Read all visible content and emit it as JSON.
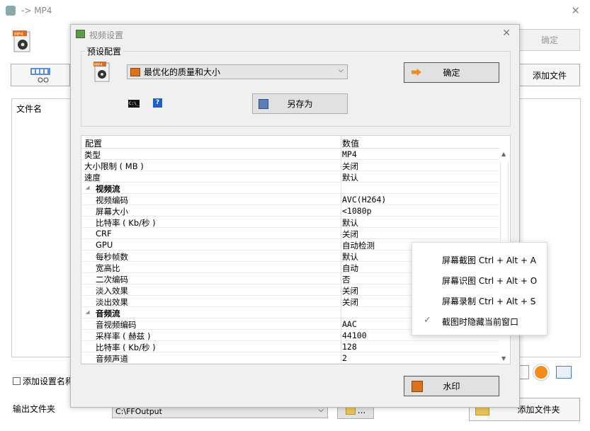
{
  "main_window": {
    "title": "-> MP4",
    "ok_button": "确定",
    "add_file_button": "添加文件",
    "file_name_header": "文件名",
    "add_settings_name_checkbox": "添加设置名称",
    "output_folder_label": "输出文件夹",
    "output_folder_value": "C:\\FFOutput",
    "browse_label": "...",
    "add_folder_button": "添加文件夹"
  },
  "dialog": {
    "title": "视频设置",
    "preset_group_label": "预设配置",
    "preset_select": "最优化的质量和大小",
    "ok_button": "确定",
    "save_as_button": "另存为",
    "watermark_button": "水印",
    "table": {
      "headers": [
        "配置",
        "数值"
      ],
      "rows": [
        {
          "k": "类型",
          "v": "MP4",
          "level": 0
        },
        {
          "k": "大小限制 ( MB )",
          "v": "关闭",
          "level": 0
        },
        {
          "k": "速度",
          "v": "默认",
          "level": 0
        },
        {
          "k": "视频流",
          "v": "",
          "level": -1
        },
        {
          "k": "视频编码",
          "v": "AVC(H264)",
          "level": 1
        },
        {
          "k": "屏幕大小",
          "v": "<1080p",
          "level": 1
        },
        {
          "k": "比特率 ( Kb/秒 )",
          "v": "默认",
          "level": 1
        },
        {
          "k": "CRF",
          "v": "关闭",
          "level": 1
        },
        {
          "k": "GPU",
          "v": "自动检测",
          "level": 1
        },
        {
          "k": "每秒帧数",
          "v": "默认",
          "level": 1
        },
        {
          "k": "宽高比",
          "v": "自动",
          "level": 1
        },
        {
          "k": "二次编码",
          "v": "否",
          "level": 1
        },
        {
          "k": "淡入效果",
          "v": "关闭",
          "level": 1
        },
        {
          "k": "淡出效果",
          "v": "关闭",
          "level": 1
        },
        {
          "k": "音频流",
          "v": "",
          "level": -1
        },
        {
          "k": "音视频编码",
          "v": "AAC",
          "level": 1
        },
        {
          "k": "采样率 ( 赫兹 )",
          "v": "44100",
          "level": 1
        },
        {
          "k": "比特率 ( Kb/秒 )",
          "v": "128",
          "level": 1
        },
        {
          "k": "音频声道",
          "v": "2",
          "level": 1
        }
      ]
    }
  },
  "context_menu": {
    "items": [
      {
        "label": "屏幕截图 Ctrl + Alt + A",
        "checked": false
      },
      {
        "label": "屏幕识图 Ctrl + Alt + O",
        "checked": false
      },
      {
        "label": "屏幕录制 Ctrl + Alt + S",
        "checked": false
      },
      {
        "label": "截图时隐藏当前窗口",
        "checked": true
      }
    ]
  },
  "colors": {
    "accent_orange": "#f28c1e",
    "help_blue": "#1f5fbf"
  }
}
